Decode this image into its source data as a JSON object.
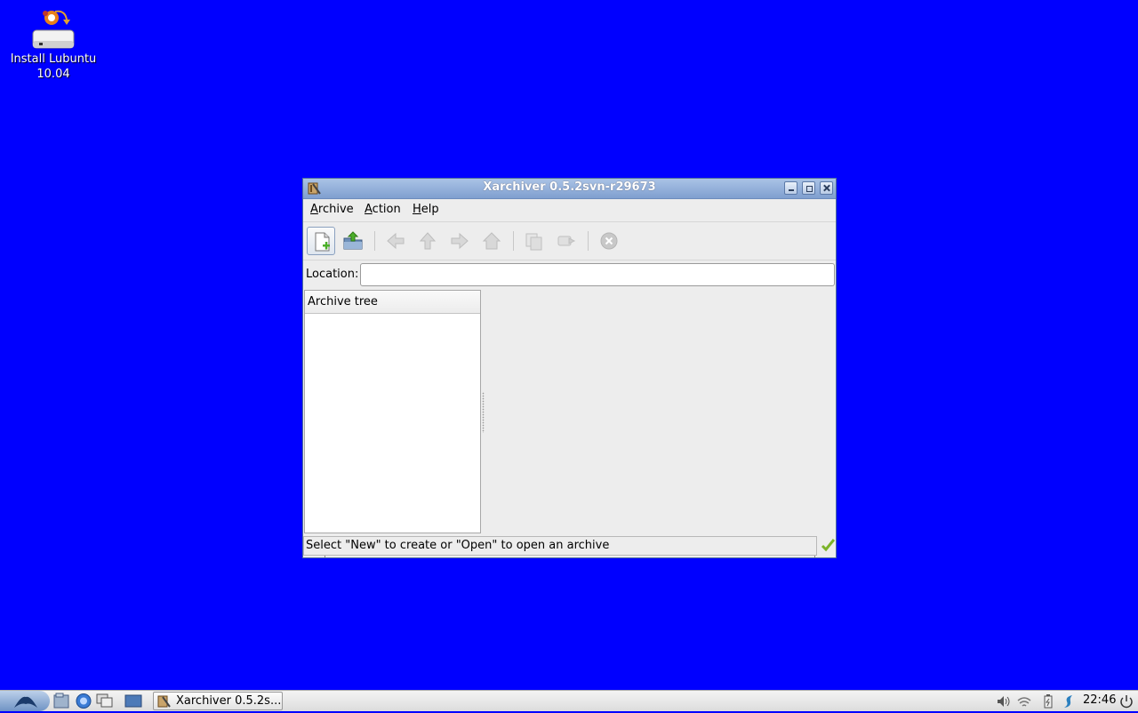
{
  "desktop": {
    "background_color": "#0000ff",
    "icons": [
      {
        "name": "install-lubuntu-icon",
        "label_line1": "Install Lubuntu",
        "label_line2": "10.04"
      }
    ]
  },
  "window": {
    "title": "Xarchiver 0.5.2svn-r29673",
    "menu": {
      "archive": {
        "underline": "A",
        "rest": "rchive"
      },
      "action": {
        "underline": "A",
        "rest": "ction"
      },
      "help": {
        "underline": "H",
        "rest": "elp"
      }
    },
    "toolbar": {
      "buttons": [
        "new-archive-icon",
        "open-archive-icon",
        "back-icon",
        "up-icon",
        "forward-icon",
        "home-icon",
        "extract-icon",
        "add-files-icon",
        "stop-icon"
      ]
    },
    "location": {
      "label": "Location:",
      "value": ""
    },
    "tree": {
      "header": "Archive tree"
    },
    "status": {
      "text": "Select \"New\" to create or \"Open\" to open an archive"
    }
  },
  "taskbar": {
    "task_label": "Xarchiver 0.5.2s...",
    "clock": "22:46"
  }
}
